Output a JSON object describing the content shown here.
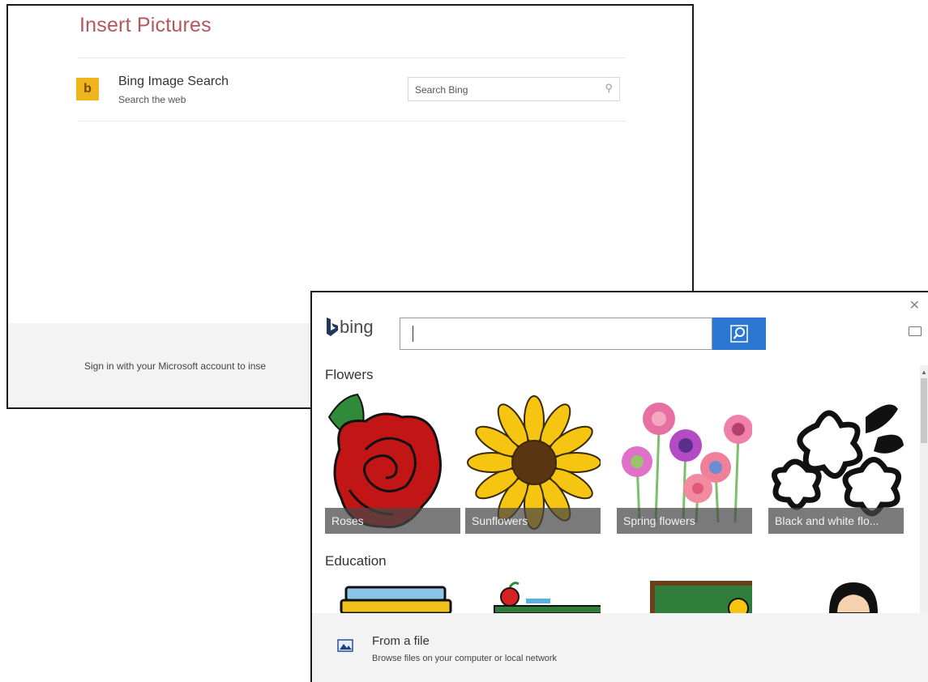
{
  "insert_pictures": {
    "title": "Insert Pictures",
    "source": {
      "badge_letter": "b",
      "name": "Bing Image Search",
      "subtitle": "Search the web",
      "search_placeholder": "Search Bing",
      "search_icon": "magnifier-icon"
    },
    "footer_text": "Sign in with your Microsoft account to inse"
  },
  "bing_picker": {
    "logo_text": "bing",
    "search_value": "",
    "close_icon": "close-icon",
    "feedback_icon": "feedback-icon",
    "categories": [
      {
        "heading": "Flowers",
        "items": [
          {
            "label": "Roses"
          },
          {
            "label": "Sunflowers"
          },
          {
            "label": "Spring flowers"
          },
          {
            "label": "Black and white flo..."
          }
        ]
      },
      {
        "heading": "Education",
        "items": [
          {
            "label": ""
          },
          {
            "label": ""
          },
          {
            "label": ""
          },
          {
            "label": ""
          }
        ]
      }
    ],
    "from_file": {
      "title": "From a file",
      "subtitle": "Browse files on your computer or local network"
    }
  },
  "colors": {
    "title_accent": "#b5565f",
    "bing_badge": "#f0b41c",
    "search_button": "#2b78d4"
  }
}
